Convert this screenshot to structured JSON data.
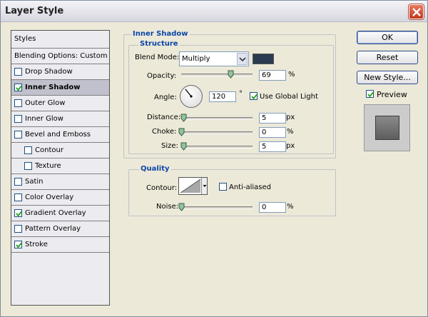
{
  "window": {
    "title": "Layer Style"
  },
  "styles_panel": {
    "header": "Styles",
    "blending_options": "Blending Options: Custom",
    "items": [
      {
        "label": "Drop Shadow",
        "checked": false,
        "selected": false,
        "sub": false
      },
      {
        "label": "Inner Shadow",
        "checked": true,
        "selected": true,
        "sub": false
      },
      {
        "label": "Outer Glow",
        "checked": false,
        "selected": false,
        "sub": false
      },
      {
        "label": "Inner Glow",
        "checked": false,
        "selected": false,
        "sub": false
      },
      {
        "label": "Bevel and Emboss",
        "checked": false,
        "selected": false,
        "sub": false
      },
      {
        "label": "Contour",
        "checked": false,
        "selected": false,
        "sub": true
      },
      {
        "label": "Texture",
        "checked": false,
        "selected": false,
        "sub": true
      },
      {
        "label": "Satin",
        "checked": false,
        "selected": false,
        "sub": false
      },
      {
        "label": "Color Overlay",
        "checked": false,
        "selected": false,
        "sub": false
      },
      {
        "label": "Gradient Overlay",
        "checked": true,
        "selected": false,
        "sub": false
      },
      {
        "label": "Pattern Overlay",
        "checked": false,
        "selected": false,
        "sub": false
      },
      {
        "label": "Stroke",
        "checked": true,
        "selected": false,
        "sub": false
      }
    ]
  },
  "inner_shadow": {
    "title": "Inner Shadow",
    "structure_title": "Structure",
    "blend_mode": {
      "label": "Blend Mode:",
      "value": "Multiply",
      "color": "#2b3a50"
    },
    "opacity": {
      "label": "Opacity:",
      "value": "69",
      "unit": "%",
      "fraction": 0.69
    },
    "angle": {
      "label": "Angle:",
      "value": "120",
      "unit": "°",
      "use_global_light": "Use Global Light",
      "use_global_checked": true
    },
    "distance": {
      "label": "Distance:",
      "value": "5",
      "unit": "px",
      "fraction": 0.03
    },
    "choke": {
      "label": "Choke:",
      "value": "0",
      "unit": "%",
      "fraction": 0.0
    },
    "size": {
      "label": "Size:",
      "value": "5",
      "unit": "px",
      "fraction": 0.03
    }
  },
  "quality": {
    "title": "Quality",
    "contour_label": "Contour:",
    "anti_aliased": "Anti-aliased",
    "anti_aliased_checked": false,
    "noise": {
      "label": "Noise:",
      "value": "0",
      "unit": "%",
      "fraction": 0.0
    }
  },
  "buttons": {
    "ok": "OK",
    "reset": "Reset",
    "new_style": "New Style...",
    "preview": "Preview",
    "preview_checked": true
  }
}
